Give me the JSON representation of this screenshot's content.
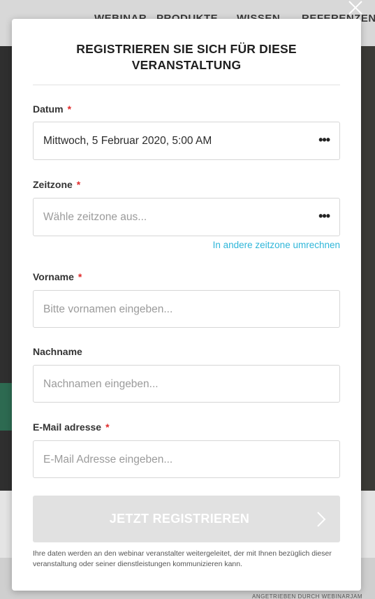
{
  "background": {
    "nav_items": [
      "WEBINAR",
      "PRODUKTE",
      "WISSEN",
      "REFERENZEN"
    ],
    "powered_by": "ANGETRIEBEN DURCH WEBINARJAM"
  },
  "modal": {
    "title": "REGISTRIEREN SIE SICH FÜR DIESE VERANSTALTUNG",
    "required_mark": "*",
    "date": {
      "label": "Datum",
      "value": "Mittwoch, 5 Februar 2020, 5:00 AM"
    },
    "timezone": {
      "label": "Zeitzone",
      "placeholder": "Wähle zeitzone aus...",
      "convert_link": "In andere zeitzone umrechnen"
    },
    "firstname": {
      "label": "Vorname",
      "placeholder": "Bitte vornamen eingeben..."
    },
    "lastname": {
      "label": "Nachname",
      "placeholder": "Nachnamen eingeben..."
    },
    "email": {
      "label": "E-Mail adresse",
      "placeholder": "E-Mail Adresse eingeben..."
    },
    "submit_label": "JETZT REGISTRIEREN",
    "disclaimer": "Ihre daten werden an den webinar veranstalter weitergeleitet, der mit Ihnen bezüglich dieser veranstaltung oder seiner dienstleistungen kommunizieren kann."
  },
  "colors": {
    "link": "#2eb6d9",
    "required": "#e02b2b",
    "submit_bg": "#e1e1e1"
  },
  "icons": [
    "close-icon",
    "more-dots-icon",
    "chevron-right-icon"
  ]
}
